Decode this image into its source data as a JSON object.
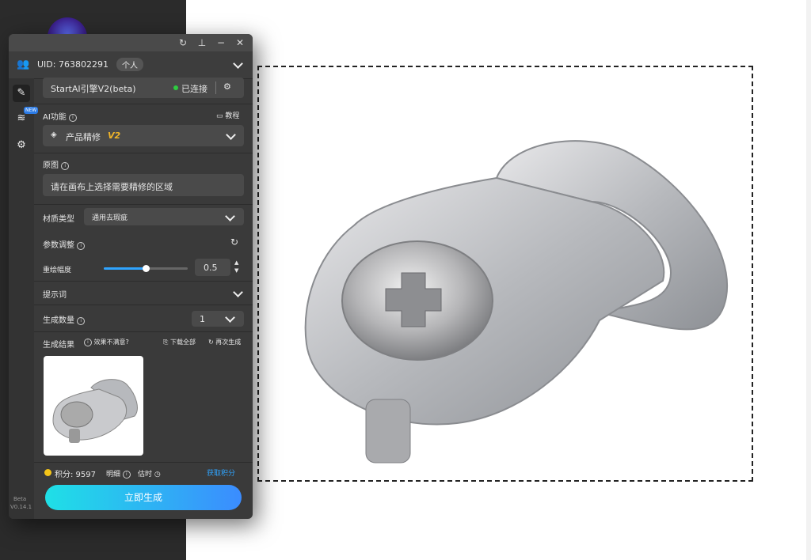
{
  "header": {
    "uid": "UID: 763802291",
    "account_type": "个人"
  },
  "engine": {
    "name": "StartAI引擎V2(beta)",
    "status": "已连接"
  },
  "ai_function": {
    "label": "AI功能",
    "tutorial": "教程",
    "selected": "产品精修",
    "version": "V2"
  },
  "original": {
    "label": "原图",
    "prompt": "请在画布上选择需要精修的区域"
  },
  "material": {
    "label": "材质类型",
    "value": "通用去瑕疵"
  },
  "params": {
    "label": "参数调整",
    "redraw_label": "重绘幅度",
    "redraw_value": "0.5",
    "redraw_level": 0.5
  },
  "hint": {
    "label": "提示词"
  },
  "count": {
    "label": "生成数量",
    "value": "1"
  },
  "results": {
    "label": "生成结果",
    "feedback": "效果不满意?",
    "download_all": "下载全部",
    "regenerate": "再次生成"
  },
  "footer": {
    "points_label": "积分: 9597",
    "details": "明细",
    "estimate": "估时",
    "get_points": "获取积分",
    "generate": "立即生成",
    "beta": "Beta",
    "version": "V0.14.1"
  },
  "colors": {
    "accent_blue": "#2fa4ff",
    "status_green": "#2ecc40",
    "gen_gradient_start": "#1fe0e6",
    "gen_gradient_end": "#3b8cff",
    "version_gold": "#f0b429",
    "points_gold": "#f5c518"
  }
}
